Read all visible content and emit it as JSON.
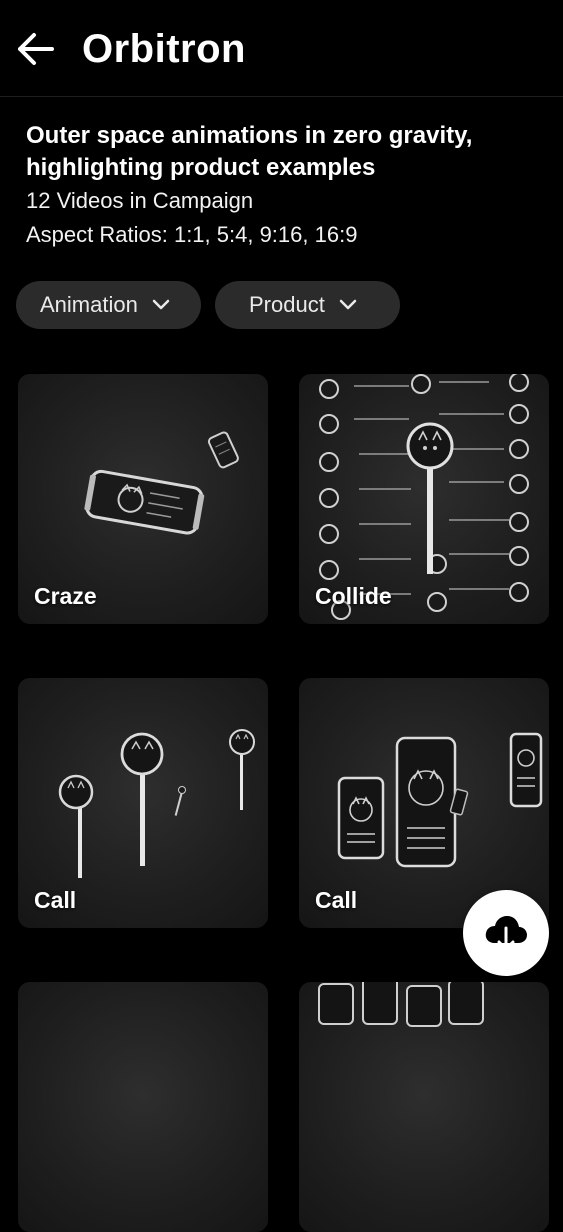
{
  "header": {
    "title": "Orbitron"
  },
  "campaign": {
    "headline": "Outer space animations in zero gravity, highlighting product examples",
    "video_count": "12 Videos in Campaign",
    "aspect_ratios": "Aspect Ratios: 1:1, 5:4, 9:16, 16:9"
  },
  "filters": [
    {
      "label": "Animation"
    },
    {
      "label": "Product"
    }
  ],
  "videos": [
    {
      "title": "Craze"
    },
    {
      "title": "Collide"
    },
    {
      "title": "Call"
    },
    {
      "title": "Call"
    }
  ],
  "icons": {
    "back": "arrow-left-icon",
    "dropdown": "chevron-down-icon",
    "download": "cloud-download-icon"
  },
  "colors": {
    "background": "#000000",
    "chip": "#2b2b2b",
    "card": "#1e1e1e",
    "fab": "#ffffff"
  }
}
